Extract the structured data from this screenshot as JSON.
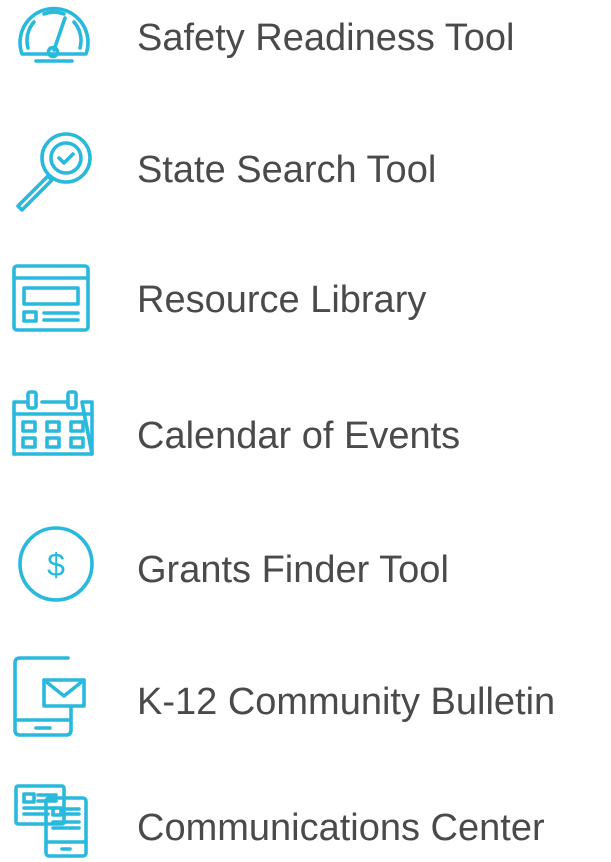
{
  "colors": {
    "accent": "#29b9dd",
    "text": "#4a4a4a",
    "background": "#ffffff"
  },
  "menu": {
    "items": [
      {
        "icon": "gauge-icon",
        "label": "Safety Readiness Tool"
      },
      {
        "icon": "magnifier-check-icon",
        "label": "State Search Tool"
      },
      {
        "icon": "browser-window-icon",
        "label": "Resource Library"
      },
      {
        "icon": "calendar-icon",
        "label": "Calendar of Events"
      },
      {
        "icon": "dollar-circle-icon",
        "label": "Grants Finder Tool"
      },
      {
        "icon": "tablet-mail-icon",
        "label": "K-12 Community Bulletin"
      },
      {
        "icon": "devices-icon",
        "label": "Communications Center"
      }
    ]
  }
}
